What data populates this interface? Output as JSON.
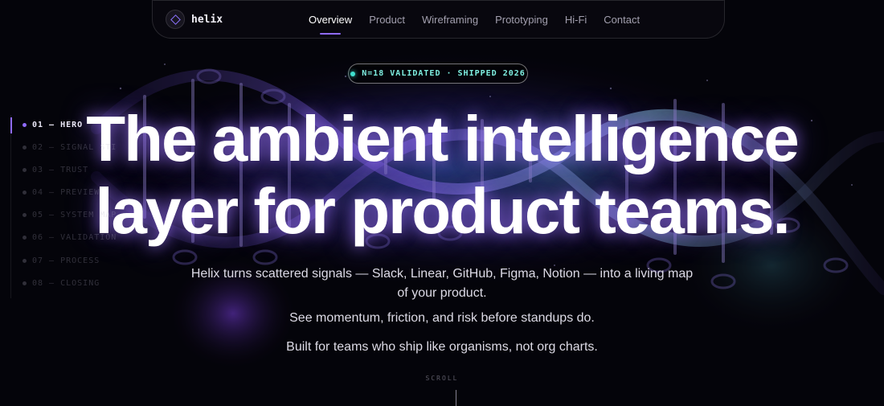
{
  "brand": {
    "name": "helix",
    "mark_icon": "diamond-icon",
    "accent": "#8f6bff"
  },
  "nav": {
    "links": [
      {
        "label": "Overview",
        "active": true
      },
      {
        "label": "Product",
        "active": false
      },
      {
        "label": "Wireframing",
        "active": false
      },
      {
        "label": "Prototyping",
        "active": false
      },
      {
        "label": "Hi-Fi",
        "active": false
      },
      {
        "label": "Contact",
        "active": false
      }
    ]
  },
  "badge": {
    "text": "N=18 VALIDATED · SHIPPED 2026",
    "color": "#3fe0cf"
  },
  "sidenav": {
    "items": [
      {
        "label": "01 — HERO",
        "active": true
      },
      {
        "label": "02 — SIGNAL STI",
        "active": false
      },
      {
        "label": "03 — TRUST",
        "active": false
      },
      {
        "label": "04 — PREVIEW",
        "active": false
      },
      {
        "label": "05 — SYSTEM MAP",
        "active": false
      },
      {
        "label": "06 — VALIDATION",
        "active": false
      },
      {
        "label": "07 — PROCESS",
        "active": false
      },
      {
        "label": "08 — CLOSING",
        "active": false
      }
    ]
  },
  "hero": {
    "headline_line1": "The ambient intelligence",
    "headline_line2": "layer for product teams.",
    "subtitle_line1": "Helix turns scattered signals — Slack, Linear, GitHub, Figma, Notion — into a living map",
    "subtitle_line2": "of your product.",
    "tagline": "See momentum, friction, and risk before standups do.",
    "closing": "Built for teams who ship like organisms, not org charts."
  },
  "scroll": {
    "label": "SCROLL"
  }
}
